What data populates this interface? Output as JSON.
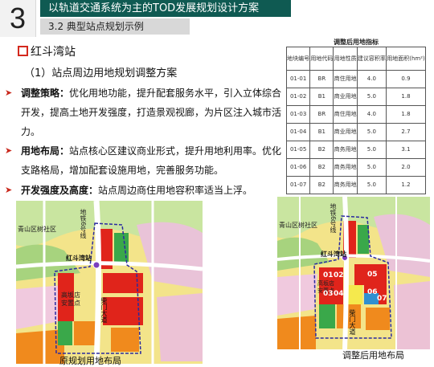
{
  "header": {
    "section_number": "3",
    "title": "以轨道交通系统为主的TOD发展规划设计方案",
    "subtitle": "3.2 典型站点规划示例"
  },
  "station": {
    "name": "红斗湾站",
    "section": "（1）站点周边用地规划调整方案"
  },
  "bullets": [
    {
      "key": "调整策略：",
      "text": "优化用地功能，提升配套服务水平，引入立体综合开发，提高土地开发强度，打造景观视廊，为片区注入城市活力。"
    },
    {
      "key": "用地布局：",
      "text": "站点核心区建议商业形式，提升用地利用率。优化支路格局，增加配套设施用地，完善服务功能。"
    },
    {
      "key": "开发强度及高度：",
      "text": "站点周边商住用地容积率适当上浮。"
    }
  ],
  "table": {
    "title": "调整后用地指标",
    "headers": [
      "地块编号",
      "用地代码",
      "用地性质",
      "建议容积率",
      "用地面积(hm²)"
    ],
    "rows": [
      [
        "01-01",
        "BR",
        "商住用地",
        "4.0",
        "0.9"
      ],
      [
        "01-02",
        "B1",
        "商业用地",
        "5.0",
        "1.8"
      ],
      [
        "01-03",
        "BR",
        "商住用地",
        "4.0",
        "1.8"
      ],
      [
        "01-04",
        "B1",
        "商业用地",
        "5.0",
        "2.7"
      ],
      [
        "01-05",
        "B2",
        "商务用地",
        "5.0",
        "3.1"
      ],
      [
        "01-06",
        "B2",
        "商务用地",
        "5.0",
        "2.0"
      ],
      [
        "01-07",
        "B2",
        "商务用地",
        "5.0",
        "1.2"
      ]
    ]
  },
  "maps": {
    "left": {
      "caption": "原规划用地布局",
      "labels": {
        "district": "青山区树社区",
        "line": "地铁6号线",
        "station": "红斗湾站",
        "housing": "高坂店安置点",
        "road": "柴门大道"
      }
    },
    "right": {
      "caption": "调整后用地布局",
      "labels": {
        "district": "青山区树社区",
        "line": "地铁6号线",
        "station": "红斗湾站",
        "housing": "高坂店安置点",
        "road": "柴门大道"
      },
      "parcels": [
        "01",
        "02",
        "05",
        "03",
        "04",
        "06",
        "07"
      ]
    }
  },
  "colors": {
    "header_bar": "#0f5a52",
    "bullet_arrow": "#c9281c",
    "commercial": "#e0241b",
    "residential": "#f5e94d",
    "green": "#3aa84a",
    "orange": "#f08a1d",
    "boundary": "#2a2aa0"
  }
}
